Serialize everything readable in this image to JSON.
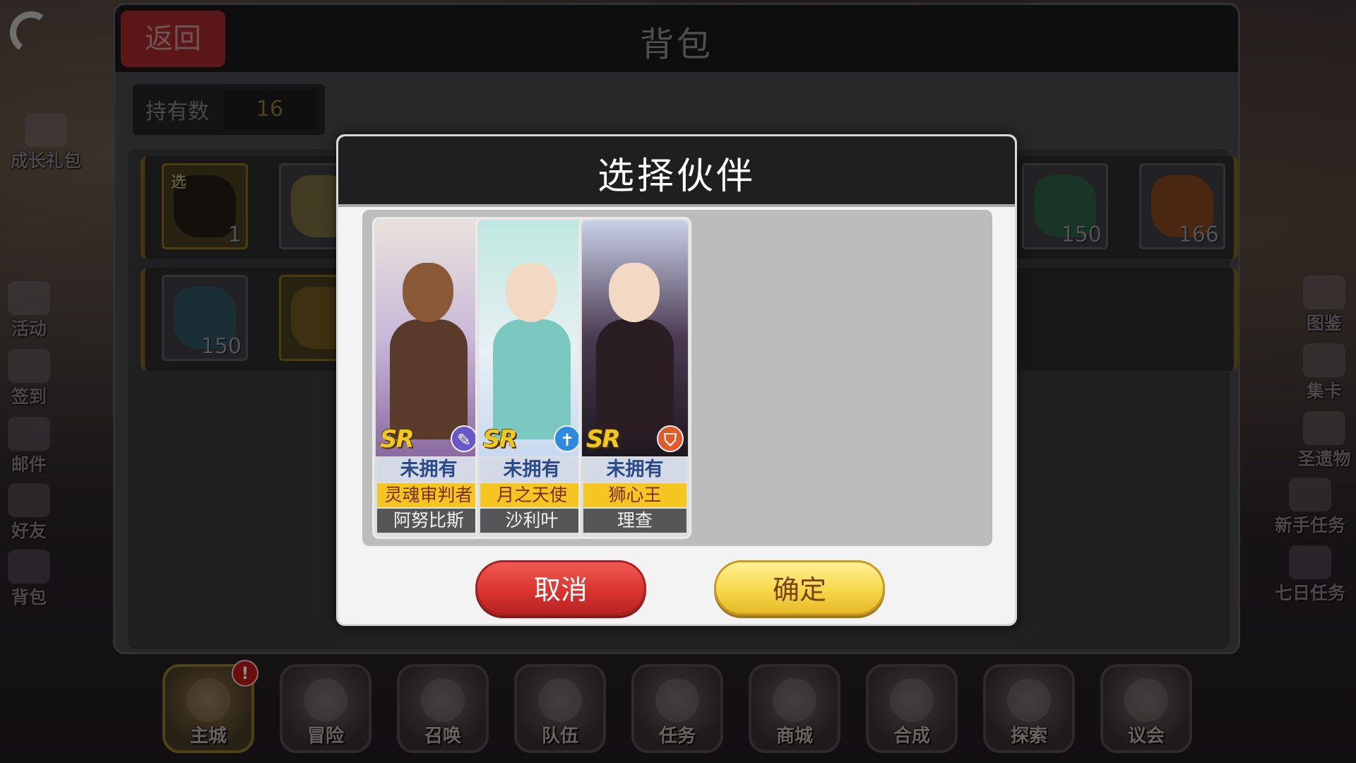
{
  "bag": {
    "title": "背包",
    "back_label": "返回",
    "held_label": "持有数",
    "held_value": "16",
    "slot_tag": "选",
    "slot_counts": [
      "1",
      "150",
      "166",
      "150"
    ]
  },
  "side_left": [
    {
      "label": "成长礼包"
    },
    {
      "label": "活动"
    },
    {
      "label": "签到"
    },
    {
      "label": "邮件"
    },
    {
      "label": "好友"
    },
    {
      "label": "背包"
    }
  ],
  "side_right": [
    {
      "label": "图鉴"
    },
    {
      "label": "集卡"
    },
    {
      "label": "圣遗物"
    },
    {
      "label": "新手任务"
    },
    {
      "label": "七日任务"
    }
  ],
  "bottom_nav": [
    {
      "label": "主城",
      "alert": "!"
    },
    {
      "label": "冒险"
    },
    {
      "label": "召唤"
    },
    {
      "label": "队伍"
    },
    {
      "label": "任务"
    },
    {
      "label": "商城"
    },
    {
      "label": "合成"
    },
    {
      "label": "探索"
    },
    {
      "label": "议会"
    }
  ],
  "modal": {
    "title": "选择伙伴",
    "cancel_label": "取消",
    "confirm_label": "确定",
    "cards": [
      {
        "rarity": "SR",
        "status": "未拥有",
        "title": "灵魂审判者",
        "name": "阿努比斯",
        "class_icon": "feather-icon",
        "class_color": "#6a58c8"
      },
      {
        "rarity": "SR",
        "status": "未拥有",
        "title": "月之天使",
        "name": "沙利叶",
        "class_icon": "cross-icon",
        "class_color": "#2d8ae0"
      },
      {
        "rarity": "SR",
        "status": "未拥有",
        "title": "狮心王",
        "name": "理查",
        "class_icon": "shield-icon",
        "class_color": "#e05a2a"
      }
    ]
  }
}
